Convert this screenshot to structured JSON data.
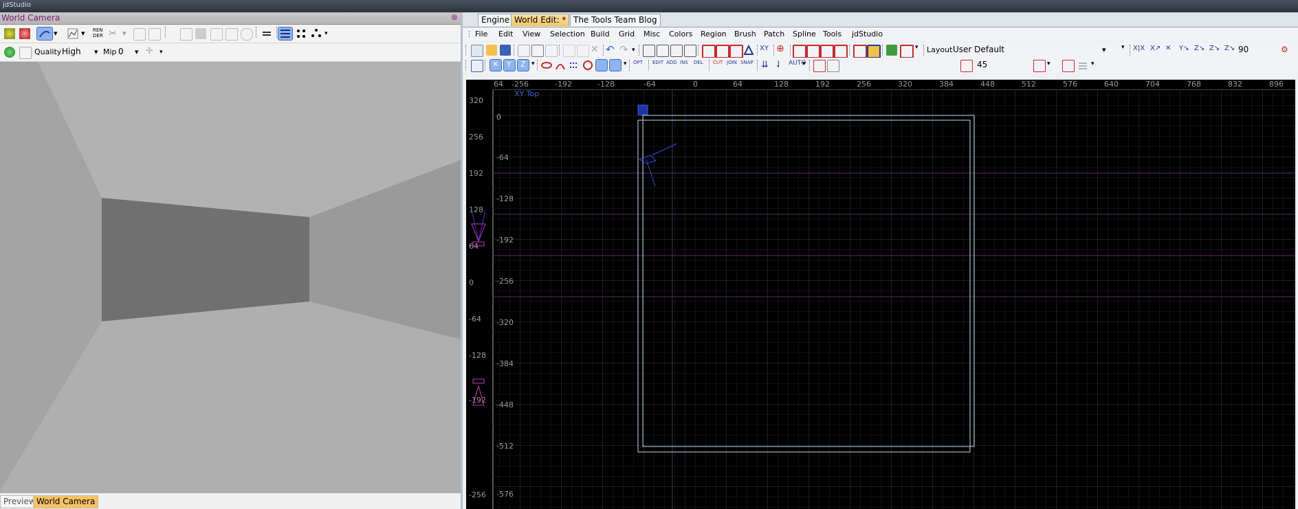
{
  "app": {
    "title": "jdStudio"
  },
  "camera_panel": {
    "title": "World Camera",
    "close_glyph": "⊗",
    "render_label": "REN DER",
    "quality_label": "Quality",
    "quality_value": "High",
    "mip_label": "Mip",
    "mip_value": "0"
  },
  "bottom_tabs": [
    {
      "label": "Preview"
    },
    {
      "label": "World Camera"
    }
  ],
  "tabs": [
    {
      "label": "Engine"
    },
    {
      "label": "World Edit: *"
    },
    {
      "label": "The Tools Team Blog"
    }
  ],
  "menu": {
    "items": [
      "File",
      "Edit",
      "View",
      "Selection",
      "Build",
      "Grid",
      "Misc",
      "Colors",
      "Region",
      "Brush",
      "Patch",
      "Spline",
      "Tools",
      "jdStudio"
    ]
  },
  "toolbar": {
    "layout_label": "Layout",
    "layout_value": "User Default",
    "rotate_value": "90",
    "angle_value": "45"
  },
  "view2d": {
    "label": "XY Top",
    "x_ticks": [
      "64",
      "-256",
      "-192",
      "-128",
      "-64",
      "0",
      "64",
      "128",
      "192",
      "256",
      "320",
      "384",
      "448",
      "512",
      "576",
      "640",
      "704",
      "768",
      "832",
      "896"
    ],
    "y_ticks": [
      "320",
      "256",
      "192",
      "128",
      "64",
      "0",
      "-64",
      "-128",
      "-192",
      "-256"
    ],
    "grid_y_ticks": [
      "0",
      "-64",
      "-128",
      "-192",
      "-256",
      "-320",
      "-384",
      "-448",
      "-512",
      "-576"
    ]
  },
  "colors": {
    "accent_tab": "#f7c364",
    "camera_title": "#7a1b7c",
    "view_label": "#3b5fd1",
    "brush_outline": "#b8dcea"
  }
}
